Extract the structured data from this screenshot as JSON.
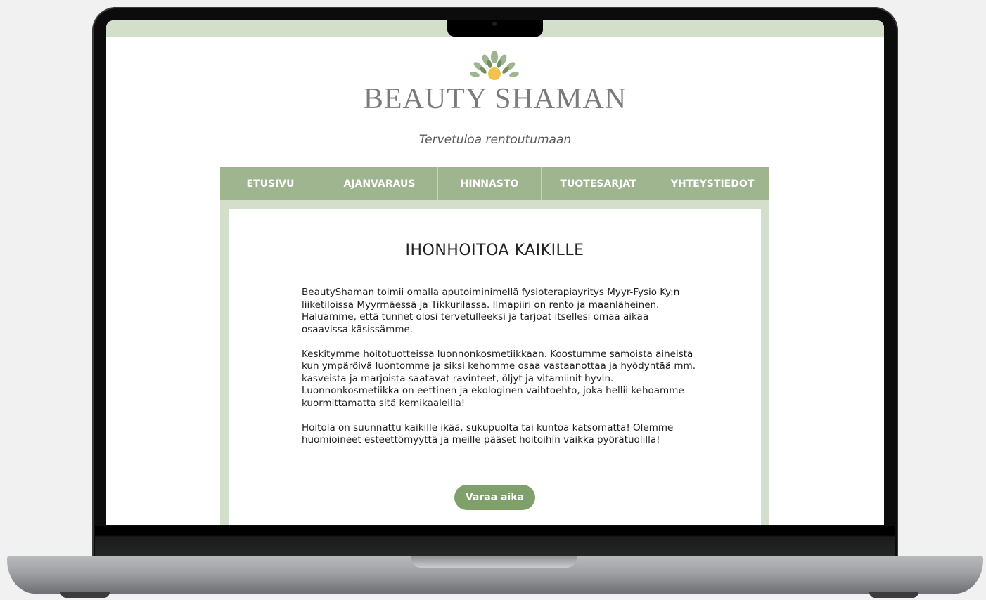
{
  "site": {
    "brand": "BEAUTY SHAMAN",
    "tagline": "Tervetuloa rentoutumaan",
    "logo_icon": "leaf-sun-icon"
  },
  "nav": {
    "items": [
      {
        "label": "ETUSIVU"
      },
      {
        "label": "AJANVARAUS"
      },
      {
        "label": "HINNASTO"
      },
      {
        "label": "TUOTESARJAT"
      },
      {
        "label": "YHTEYSTIEDOT"
      }
    ]
  },
  "main": {
    "heading": "IHONHOITOA KAIKILLE",
    "paragraphs": [
      "BeautyShaman toimii omalla aputoiminimellä fysioterapiayritys Myyr-Fysio Ky:n liiketiloissa Myyrmäessä ja Tikkurilassa. Ilmapiiri on rento ja maanläheinen. Haluamme, että tunnet olosi tervetulleeksi ja tarjoat itsellesi omaa aikaa osaavissa käsissämme.",
      "Keskitymme hoitotuotteissa luonnonkosmetiikkaan. Koostumme samoista aineista kun ympäröivä luontomme ja siksi kehomme osaa vastaanottaa ja hyödyntää mm. kasveista ja marjoista saatavat ravinteet, öljyt ja vitamiinit hyvin. Luonnonkosmetiikka on eettinen ja ekologinen vaihtoehto, joka hellii kehoamme kuormittamatta sitä kemikaaleilla!",
      "Hoitola on suunnattu kaikille ikää, sukupuolta tai kuntoa katsomatta! Olemme huomioineet esteettömyyttä ja meille pääset hoitoihin vaikka pyörätuolilla!"
    ],
    "cta_label": "Varaa aika"
  },
  "colors": {
    "nav_green": "#9eb58f",
    "light_green": "#d3dfca",
    "button_green": "#7fa06a",
    "logo_sun": "#f2c14e"
  }
}
